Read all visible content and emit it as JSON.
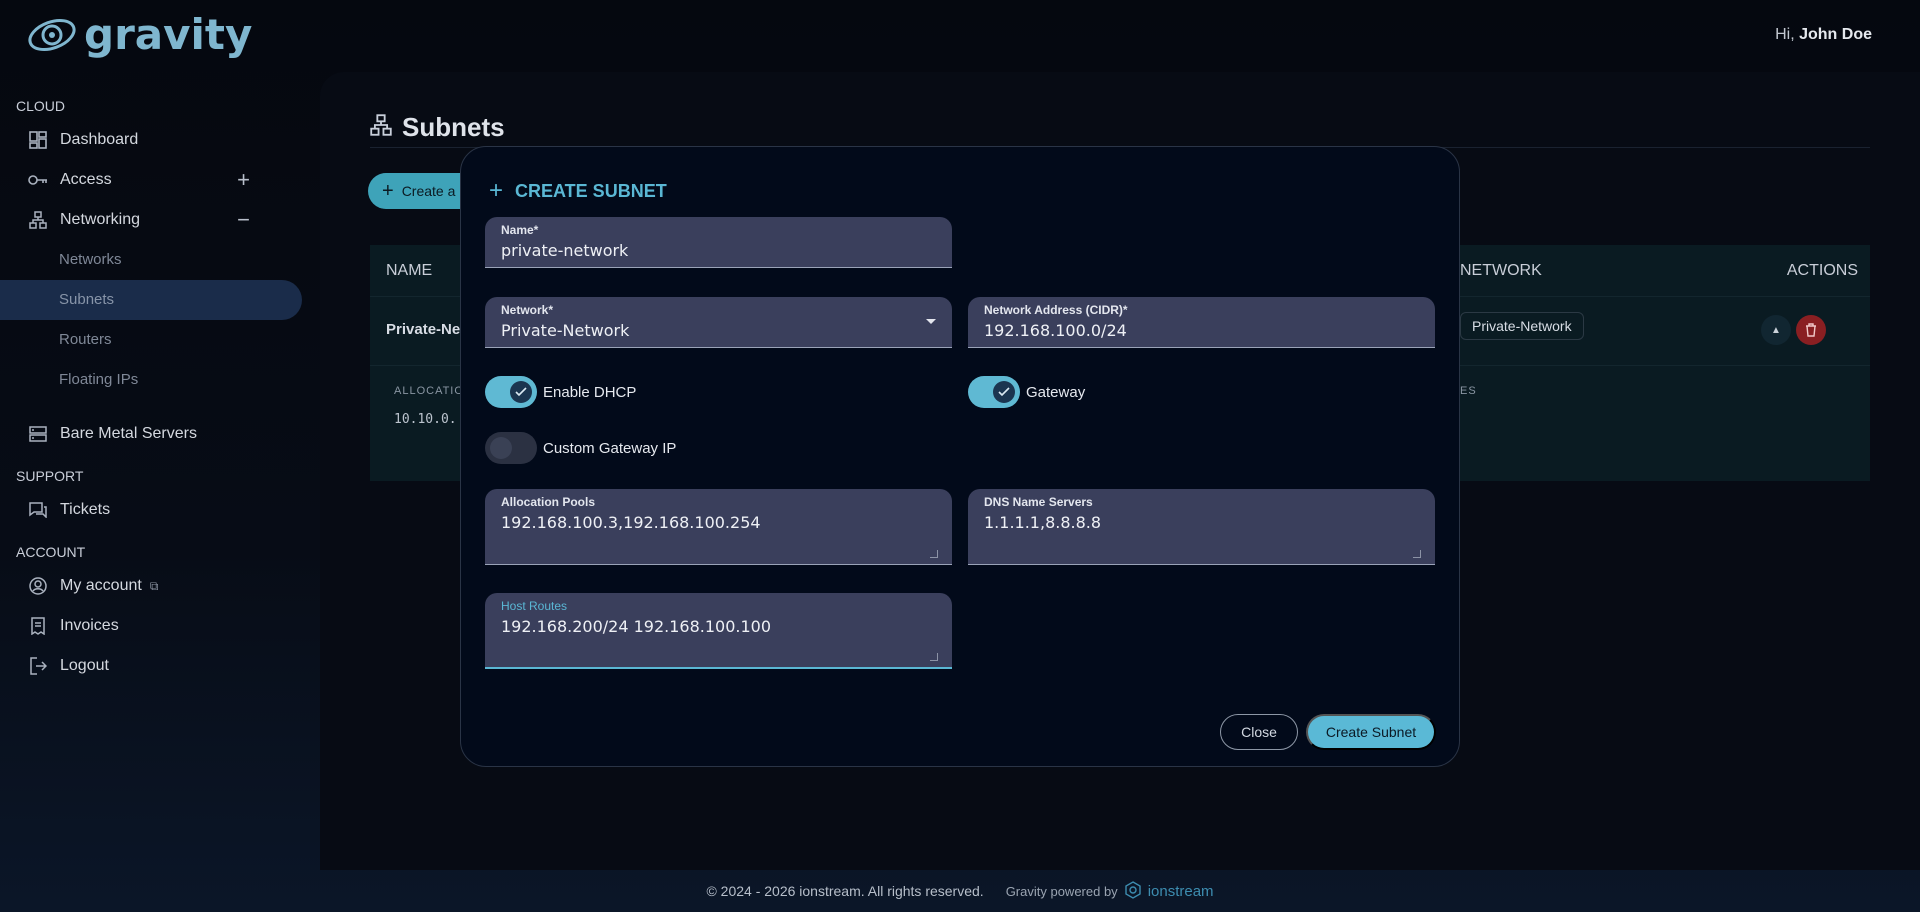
{
  "app": {
    "brand": "gravity"
  },
  "header": {
    "greeting_prefix": "Hi, ",
    "user_name": "John Doe"
  },
  "sidebar": {
    "sections": {
      "cloud": "CLOUD",
      "support": "SUPPORT",
      "account": "ACCOUNT"
    },
    "dashboard": "Dashboard",
    "access": "Access",
    "networking": "Networking",
    "networking_sub": {
      "networks": "Networks",
      "subnets": "Subnets",
      "routers": "Routers",
      "floating_ips": "Floating IPs"
    },
    "bare_metal": "Bare Metal Servers",
    "tickets": "Tickets",
    "my_account": "My account",
    "invoices": "Invoices",
    "logout": "Logout",
    "access_toggle": "+",
    "networking_toggle": "−"
  },
  "main": {
    "title": "Subnets",
    "create_button": "Create a",
    "table": {
      "col_name": "NAME",
      "col_network": "NETWORK",
      "col_actions": "ACTIONS",
      "row_name": "Private-Ne",
      "row_network": "Private-Network",
      "alloc_label": "ALLOCATION",
      "alloc_value": "10.10.0.",
      "es_label": "ES"
    }
  },
  "modal": {
    "title": "CREATE SUBNET",
    "name_label": "Name*",
    "name_value": "private-network",
    "network_label": "Network*",
    "network_value": "Private-Network",
    "cidr_label": "Network Address (CIDR)*",
    "cidr_value": "192.168.100.0/24",
    "enable_dhcp": "Enable DHCP",
    "gateway": "Gateway",
    "custom_gateway_ip": "Custom Gateway IP",
    "alloc_pools_label": "Allocation Pools",
    "alloc_pools_value": "192.168.100.3,192.168.100.254",
    "dns_label": "DNS Name Servers",
    "dns_value": "1.1.1.1,8.8.8.8",
    "host_routes_label": "Host Routes",
    "host_routes_value": "192.168.200/24 192.168.100.100",
    "close_button": "Close",
    "create_button": "Create Subnet",
    "switches": {
      "enable_dhcp": true,
      "gateway": true,
      "custom_gateway_ip": false
    }
  },
  "footer": {
    "copyright": "© 2024 - 2026 ionstream. All rights reserved.",
    "powered_by": "Gravity powered by",
    "brand": "ionstream"
  },
  "colors": {
    "accent": "#5ab7d4",
    "danger": "#8a1f22",
    "active_nav": "#1a2c4a"
  }
}
